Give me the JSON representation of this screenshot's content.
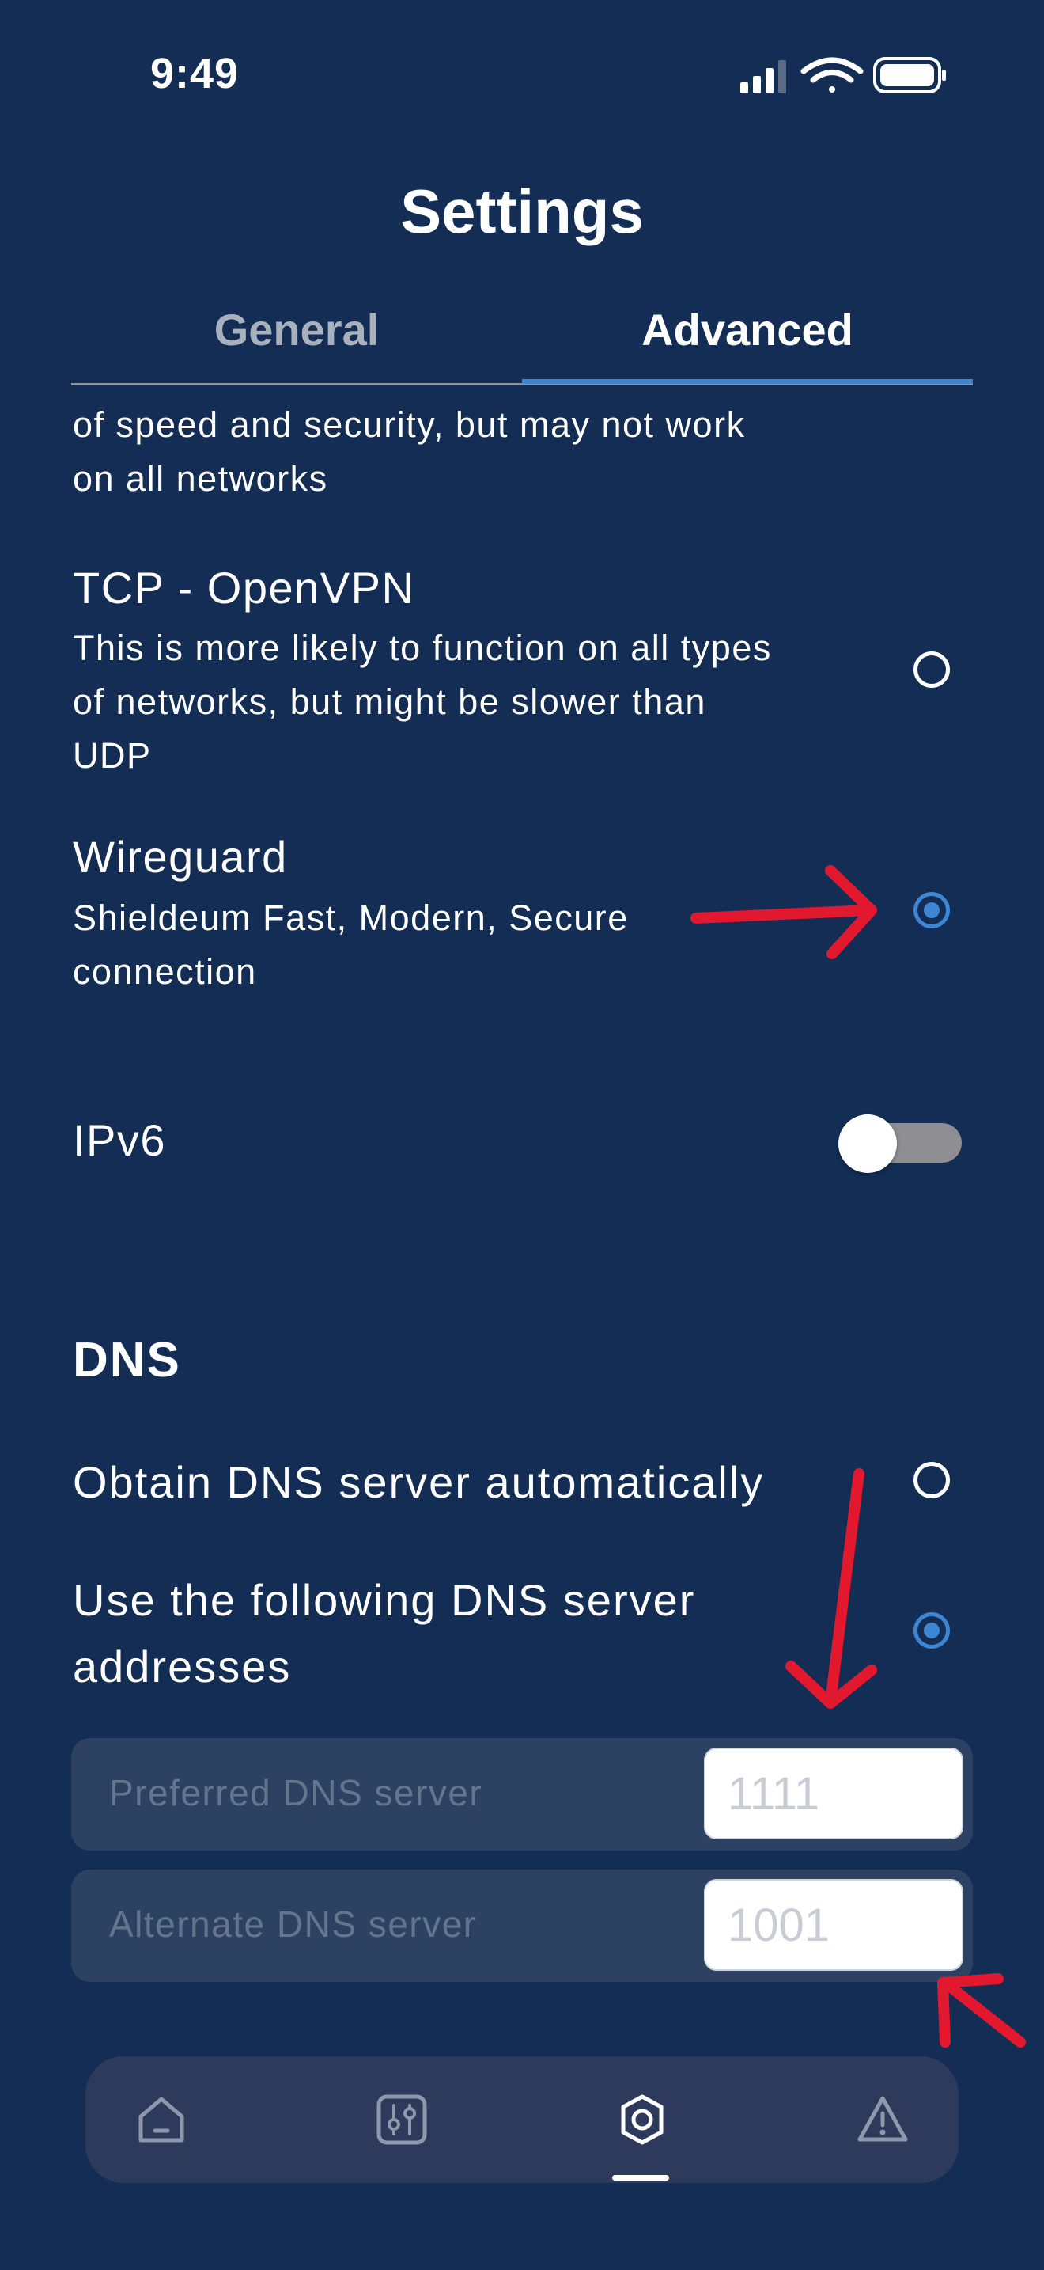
{
  "status_bar": {
    "time": "9:49"
  },
  "header": {
    "title": "Settings"
  },
  "tabs": [
    {
      "label": "General",
      "active": false
    },
    {
      "label": "Advanced",
      "active": true
    }
  ],
  "protocols": {
    "partial_desc_line1": "of speed and security, but may not work",
    "partial_desc_line2": "on all networks",
    "tcp": {
      "title": "TCP - OpenVPN",
      "desc_line1": "This is more likely to function on all types",
      "desc_line2": "of networks, but might be slower than",
      "desc_line3": "UDP",
      "selected": false
    },
    "wireguard": {
      "title": "Wireguard",
      "desc_line1": "Shieldeum Fast, Modern, Secure",
      "desc_line2": "connection",
      "selected": true
    }
  },
  "ipv6": {
    "label": "IPv6",
    "enabled": false
  },
  "dns": {
    "section_title": "DNS",
    "auto_label": "Obtain DNS server automatically",
    "auto_selected": false,
    "manual_label_line1": "Use the following DNS server",
    "manual_label_line2": "addresses",
    "manual_selected": true,
    "preferred": {
      "label": "Preferred DNS server",
      "placeholder": "1111"
    },
    "alternate": {
      "label": "Alternate DNS server",
      "placeholder": "1001"
    }
  },
  "tabbar": {
    "items": [
      {
        "icon": "home-icon",
        "active": false
      },
      {
        "icon": "sliders-icon",
        "active": false
      },
      {
        "icon": "settings-icon",
        "active": true
      },
      {
        "icon": "warning-icon",
        "active": false
      }
    ]
  },
  "colors": {
    "background": "#142d54",
    "accent": "#3d86d3",
    "annotation": "#e2182f"
  }
}
